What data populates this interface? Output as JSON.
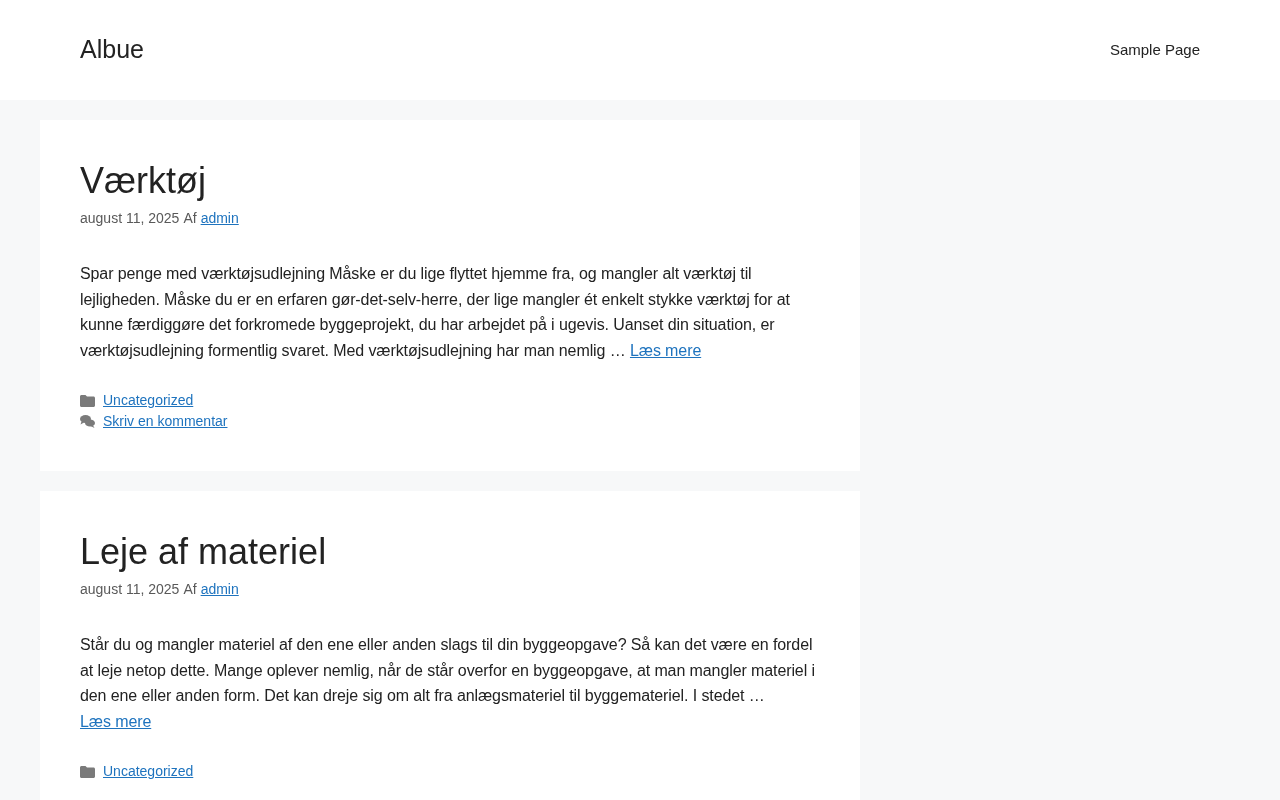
{
  "site": {
    "title": "Albue",
    "nav": [
      "Sample Page"
    ]
  },
  "posts": [
    {
      "title": "Værktøj",
      "date": "august 11, 2025",
      "by": "Af",
      "author": "admin",
      "excerpt": "Spar penge med værktøjsudlejning Måske er du lige flyttet hjemme fra, og mangler alt værktøj til lejligheden. Måske du er en erfaren gør-det-selv-herre, der lige mangler ét enkelt stykke værktøj for at kunne færdiggøre det forkromede byggeprojekt, du har arbejdet på i ugevis. Uanset din situation, er værktøjsudlejning formentlig svaret. Med værktøjsudlejning har man nemlig …",
      "more": "Læs mere",
      "category": "Uncategorized",
      "comment": "Skriv en kommentar"
    },
    {
      "title": "Leje af materiel",
      "date": "august 11, 2025",
      "by": "Af",
      "author": "admin",
      "excerpt": "Står du og mangler materiel af den ene eller anden slags til din byggeopgave? Så kan det være en fordel at leje netop dette. Mange oplever nemlig, når de står overfor en byggeopgave, at man mangler materiel i den ene eller anden form. Det kan dreje sig om alt fra anlægsmateriel til byggemateriel. I stedet …",
      "more": "Læs mere",
      "category": "Uncategorized"
    }
  ]
}
